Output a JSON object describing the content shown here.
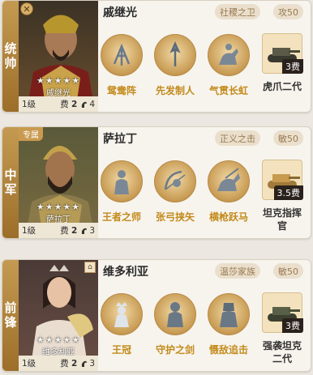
{
  "cards": [
    {
      "position": "统帅",
      "name": "戚继光",
      "tag_title": "社稷之卫",
      "tag_stat": "攻50",
      "portrait_name": "戚继光",
      "stars": "★★★★★",
      "level": "1级",
      "cost_label": "费",
      "cost_value": "2",
      "troop_count": "4",
      "skills": [
        "鸳鸯阵",
        "先发制人",
        "气贯长虹"
      ],
      "equipment": {
        "name": "虎爪二代",
        "fee": "3费"
      }
    },
    {
      "position": "中军",
      "badge": "专属",
      "name": "萨拉丁",
      "tag_title": "正义之击",
      "tag_stat": "敏50",
      "portrait_name": "萨拉丁",
      "stars": "★★★★★",
      "level": "1级",
      "cost_label": "费",
      "cost_value": "2",
      "troop_count": "3",
      "skills": [
        "王者之师",
        "张弓挟矢",
        "横枪跃马"
      ],
      "equipment": {
        "name": "坦克指挥官",
        "fee": "3.5费"
      }
    },
    {
      "position": "前锋",
      "name": "维多利亚",
      "tag_title": "温莎家族",
      "tag_stat": "敏50",
      "portrait_name": "维多利亚",
      "stars": "★★★★★",
      "level": "1级",
      "cost_label": "费",
      "cost_value": "2",
      "troop_count": "3",
      "skills": [
        "王冠",
        "守护之剑",
        "慑敌追击"
      ],
      "equipment": {
        "name": "强袭坦克二代",
        "fee": "3费"
      }
    }
  ]
}
